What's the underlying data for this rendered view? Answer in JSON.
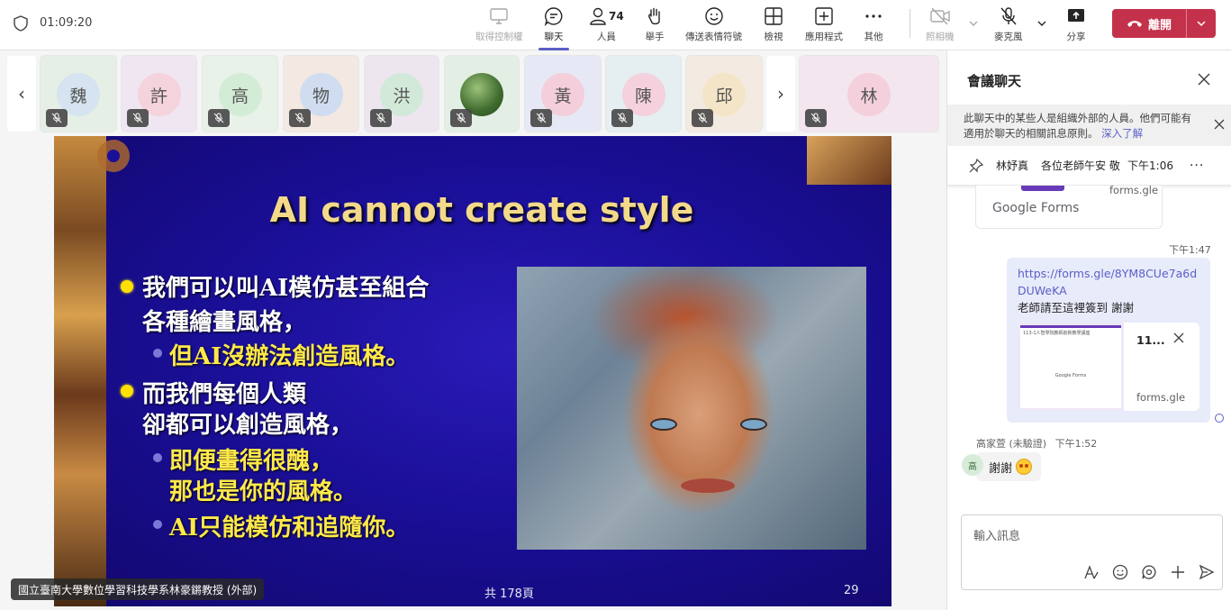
{
  "topbar": {
    "timer": "01:09:20",
    "buttons": {
      "take_control": "取得控制權",
      "chat": "聊天",
      "people": "人員",
      "people_count": "74",
      "raise_hand": "舉手",
      "reactions": "傳送表情符號",
      "view": "檢視",
      "apps": "應用程式",
      "more": "其他",
      "camera": "照相機",
      "mic": "麥克風",
      "share": "分享",
      "leave": "離開"
    }
  },
  "participants": [
    {
      "initial": "魏",
      "bg": "#d6e3f0",
      "tile": "#e6efe6"
    },
    {
      "initial": "許",
      "bg": "#f5d3dc",
      "tile": "#efe6f2"
    },
    {
      "initial": "高",
      "bg": "#d3ecd6",
      "tile": "#e9f2e8"
    },
    {
      "initial": "物",
      "bg": "#d0dcf0",
      "tile": "#f3e8e2"
    },
    {
      "initial": "洪",
      "bg": "#d2e9d9",
      "tile": "#ede6ef"
    },
    {
      "initial": "",
      "bg": "#4f7d3f",
      "tile": "#e3efe5"
    },
    {
      "initial": "黃",
      "bg": "#f4cedb",
      "tile": "#e6e9f5"
    },
    {
      "initial": "陳",
      "bg": "#f4d1dc",
      "tile": "#e5eef0"
    },
    {
      "initial": "邱",
      "bg": "#f5e5c8",
      "tile": "#f3eae1"
    },
    {
      "initial": "林",
      "bg": "#f4cfdc",
      "tile": "#f3e6ee"
    }
  ],
  "slide": {
    "title": "AI cannot create style",
    "lines": [
      "我們可以叫AI模仿甚至組合",
      "各種繪畫風格，",
      "但AI沒辦法創造風格。",
      "而我們每個人類",
      "卻都可以創造風格，",
      "即便畫得很醜，",
      "那也是你的風格。",
      "AI只能模仿和追隨你。"
    ],
    "total_pages": "共 178頁",
    "page_number": "29",
    "presenter_caption": "國立臺南大學數位學習科技學系林豪鏘教授 (外部)"
  },
  "chat": {
    "title": "會議聊天",
    "notice": "此聊天中的某些人是組織外部的人員。他們可能有適用於聊天的相關訊息原則。",
    "notice_link": "深入了解",
    "pinned": {
      "name": "林妤真",
      "message": "各位老師午安 敬...",
      "time": "下午1:06"
    },
    "prev_card": {
      "brand": "Google Forms",
      "domain": "forms.gle"
    },
    "my_message": {
      "time": "下午1:47",
      "link": "https://forms.gle/8YM8CUe7a6dDUWeKA",
      "text": "老師請至這裡簽到 謝謝",
      "card_title": "11...",
      "card_domain": "forms.gle",
      "thumb_title": "113-1人智學院教師創新教學講座",
      "thumb_footer": "Google Forms"
    },
    "other_message": {
      "sender": "高家萱 (未驗證)",
      "time": "下午1:52",
      "initial": "高",
      "text": "謝謝"
    },
    "compose_placeholder": "輸入訊息"
  }
}
